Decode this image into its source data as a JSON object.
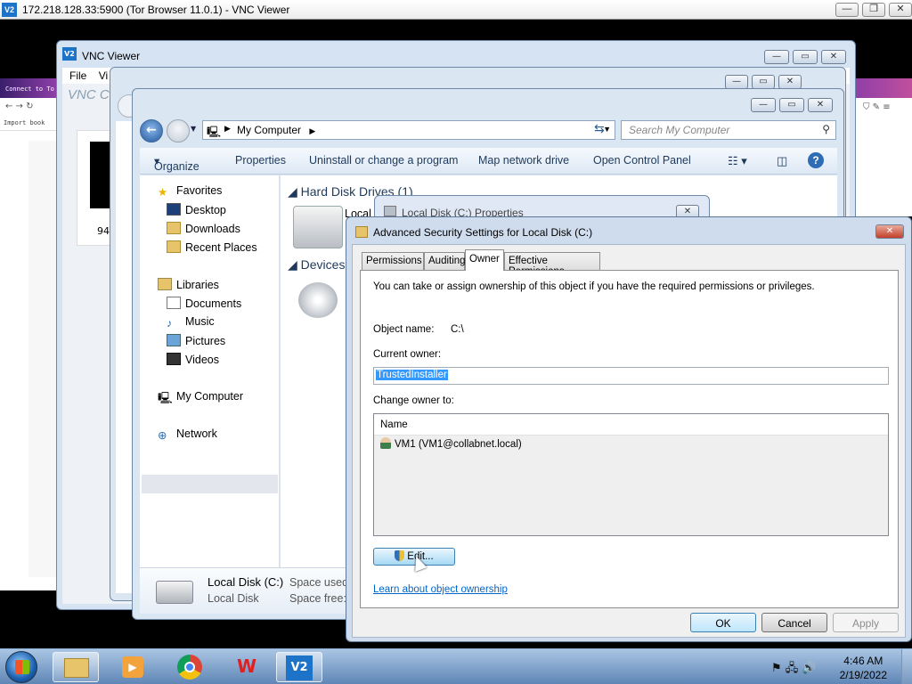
{
  "outer": {
    "title": "172.218.128.33:5900 (Tor Browser 11.0.1) - VNC Viewer",
    "min": "—",
    "max": "❐",
    "close": "✕"
  },
  "vnc_back": {
    "title": "VNC Viewer",
    "menu_file": "File",
    "menu_view": "Vi",
    "brand": "VNC C",
    "ip_frag": "94."
  },
  "browser_bg": {
    "text1": "Connect to To",
    "import": "Import book"
  },
  "explorer": {
    "address": "My Computer",
    "search_placeholder": "Search My Computer",
    "toolbar": {
      "organize": "Organize",
      "properties": "Properties",
      "uninstall": "Uninstall or change a program",
      "map_drive": "Map network drive",
      "control_panel": "Open Control Panel"
    },
    "nav": {
      "favorites": "Favorites",
      "desktop": "Desktop",
      "downloads": "Downloads",
      "recent": "Recent Places",
      "libraries": "Libraries",
      "documents": "Documents",
      "music": "Music",
      "pictures": "Pictures",
      "videos": "Videos",
      "my_computer": "My Computer",
      "network": "Network"
    },
    "sections": {
      "hdd": "Hard Disk Drives (1)",
      "devices": "Devices",
      "hdd_item": "Local D"
    },
    "details": {
      "name": "Local Disk (C:)",
      "type": "Local Disk",
      "used_label": "Space used:",
      "free_label": "Space free:",
      "free_frag": "1"
    }
  },
  "props": {
    "title": "Local Disk (C:) Properties"
  },
  "adv": {
    "title": "Advanced Security Settings for Local Disk (C:)",
    "tabs": [
      "Permissions",
      "Auditing",
      "Owner",
      "Effective Permissions"
    ],
    "info": "You can take or assign ownership of this object if you have the required permissions or privileges.",
    "object_label": "Object name:",
    "object_value": "C:\\",
    "current_owner_label": "Current owner:",
    "current_owner_value": "TrustedInstaller",
    "change_owner_label": "Change owner to:",
    "list_header": "Name",
    "list_items": [
      "VM1 (VM1@collabnet.local)"
    ],
    "edit_button": "Edit...",
    "learn_link": "Learn about object ownership",
    "ok": "OK",
    "cancel": "Cancel",
    "apply": "Apply"
  },
  "taskbar": {
    "time": "4:46 AM",
    "date": "2/19/2022"
  }
}
